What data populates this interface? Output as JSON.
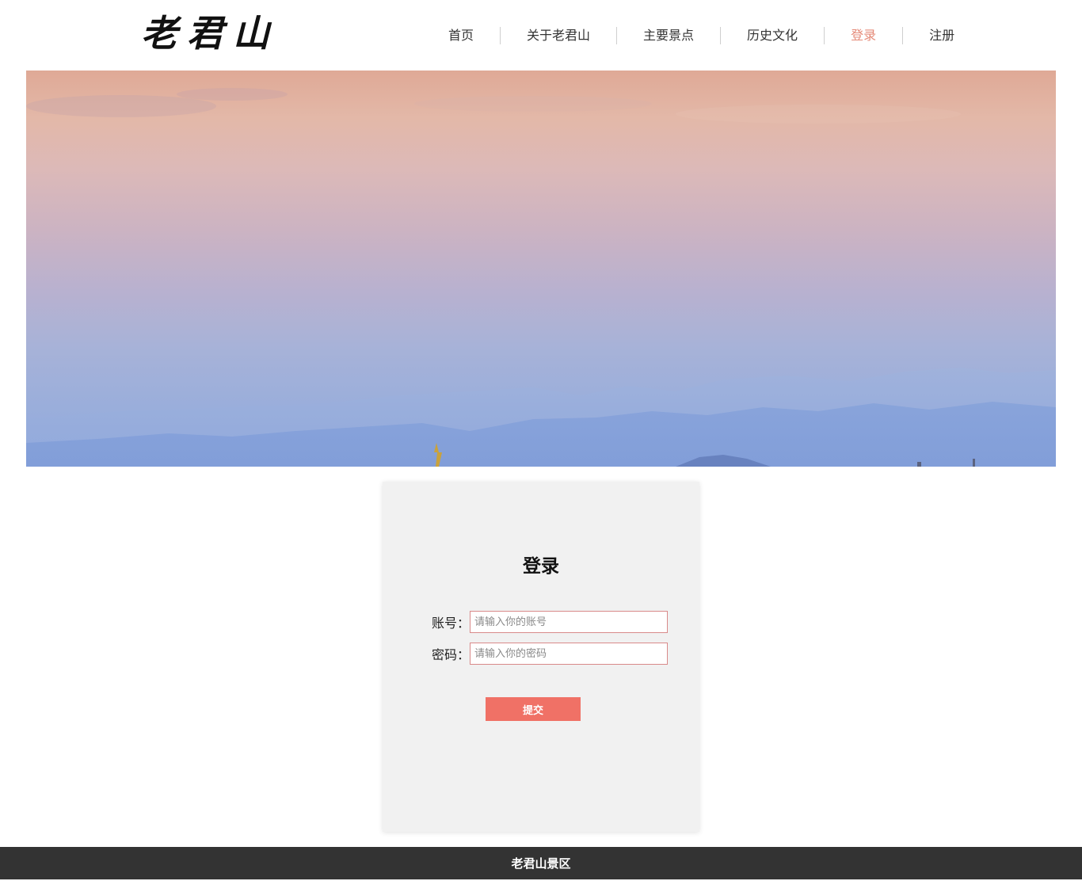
{
  "header": {
    "logo_text": "老君山",
    "nav": [
      {
        "label": "首页",
        "active": false
      },
      {
        "label": "关于老君山",
        "active": false
      },
      {
        "label": "主要景点",
        "active": false
      },
      {
        "label": "历史文化",
        "active": false
      },
      {
        "label": "登录",
        "active": true
      },
      {
        "label": "注册",
        "active": false
      }
    ]
  },
  "login": {
    "title": "登录",
    "account_label": "账号：",
    "account_placeholder": "请输入你的账号",
    "account_value": "",
    "password_label": "密码：",
    "password_placeholder": "请输入你的密码",
    "password_value": "",
    "submit_label": "提交"
  },
  "footer": {
    "text": "老君山景区"
  },
  "colors": {
    "accent": "#f07166",
    "nav_active": "#e58a78",
    "footer_bg": "#333333",
    "card_bg": "#f1f1f1"
  }
}
